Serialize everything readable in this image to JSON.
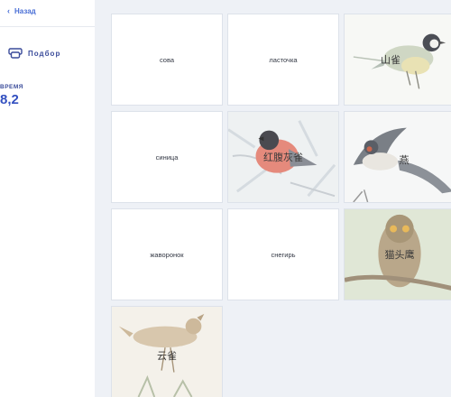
{
  "sidebar": {
    "back_label": "Назад",
    "mode_label": "Подбор",
    "time_label": "ВРЕМЯ",
    "time_value": "8,2"
  },
  "cards": [
    {
      "type": "word",
      "text": "сова"
    },
    {
      "type": "word",
      "text": "ласточка"
    },
    {
      "type": "image",
      "text": "山雀",
      "icon": "titmouse-image"
    },
    {
      "type": "word",
      "text": "синица"
    },
    {
      "type": "image",
      "text": "红腹灰雀",
      "icon": "bullfinch-image"
    },
    {
      "type": "image",
      "text": "燕",
      "icon": "swallow-image"
    },
    {
      "type": "word",
      "text": "жаворонок"
    },
    {
      "type": "word",
      "text": "снегирь"
    },
    {
      "type": "image",
      "text": "猫头鹰",
      "icon": "owl-image"
    },
    {
      "type": "image",
      "text": "云雀",
      "icon": "lark-image"
    }
  ],
  "colors": {
    "accent": "#3350c0",
    "board_bg": "#eef1f6",
    "card_border": "#dde2ea"
  }
}
